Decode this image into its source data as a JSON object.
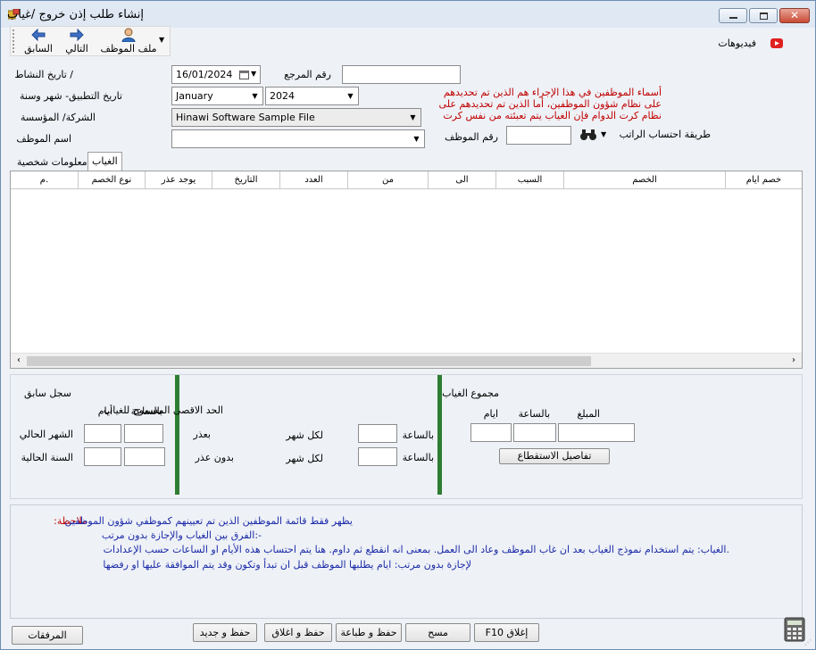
{
  "window": {
    "title": "إنشاء طلب إذن خروج /غياب"
  },
  "toolbar": {
    "prev_label": "السابق",
    "next_label": "التالي",
    "employee_file_label": "ملف الموظف"
  },
  "videos_link": "فيديوهات",
  "form": {
    "activity_date_label": "/ تاريخ النشاط",
    "activity_date_value": "16/01/2024",
    "reference_label": "رقم المرجع",
    "reference_value": "",
    "apply_date_label": "تاريخ التطبيق- شهر وسنة",
    "month_value": "January",
    "year_value": "2024",
    "company_label": "الشركة/ المؤسسة",
    "company_value": "Hinawi Software Sample File",
    "employee_name_label": "اسم الموظف",
    "employee_name_value": "",
    "employee_number_label": "رقم الموظف",
    "employee_number_value": "",
    "salary_method_label": "طريقة احتساب الراتب"
  },
  "info_note": {
    "line1": "أسماء الموظفين في هذا الإجراء هم الذين تم تحديدهم",
    "line2": "على نظام شؤون الموظفين، أما الذين تم تحديدهم على",
    "line3": "نظام كرت الدوام فإن الغياب يتم تعبئته من نفس كرت"
  },
  "tabs": [
    {
      "label": "معلومات شخصية"
    },
    {
      "label": "الغياب"
    }
  ],
  "grid": {
    "columns": [
      "خصم ايام",
      "الخصم",
      "السبب",
      "الى",
      "من",
      "العدد",
      "التاريخ",
      "يوجد عذر",
      "نوع الخصم",
      "م."
    ]
  },
  "previous_record": {
    "title": "سجل سابق",
    "hours_label": "بالساعة",
    "days_label": "أيام",
    "current_month_label": "الشهر الحالي",
    "current_year_label": "السنة الحالية"
  },
  "max_allowed": {
    "title": "الحد الاقصى المسموح للغياب",
    "with_excuse_label": "بعذر",
    "without_excuse_label": "بدون عذر",
    "per_month_label_1": "لكل شهر",
    "per_month_label_2": "لكل شهر",
    "hourly_label_1": "بالساعة",
    "hourly_label_2": "بالساعة"
  },
  "absence_total": {
    "title": "مجموع الغياب",
    "days_label": "ايام",
    "hours_label": "بالساعة",
    "amount_label": "المبلغ",
    "deduction_details_button": "تفاصيل الاستقطاع"
  },
  "notes": {
    "label": "ملاحظة:",
    "line1": "يظهر فقط قائمة الموظفين الذين تم تعيينهم كموظفي شؤون الموظفين",
    "line2": "-:الفرق بين الغياب والإجازة بدون مرتب",
    "line3": ".الغياب: يتم استخدام نموذج الغياب بعد ان غاب الموظف وعاد الى العمل. بمعنى انه انقطع ثم داوم. هنا يتم احتساب هذه الأيام او الساعات حسب الإعدادات",
    "line4": "لإجازة بدون مرتب: ايام يطلبها الموظف قبل ان تبدأ وتكون وقد يتم الموافقة عليها او رفضها"
  },
  "footer": {
    "attachments": "المرفقات",
    "save_new": "حفظ و جديد",
    "save_close": "حفظ و اغلاق",
    "save_print": "حفظ و طباعة",
    "clear": "مسح",
    "close_f10": "F10 إغلاق"
  }
}
